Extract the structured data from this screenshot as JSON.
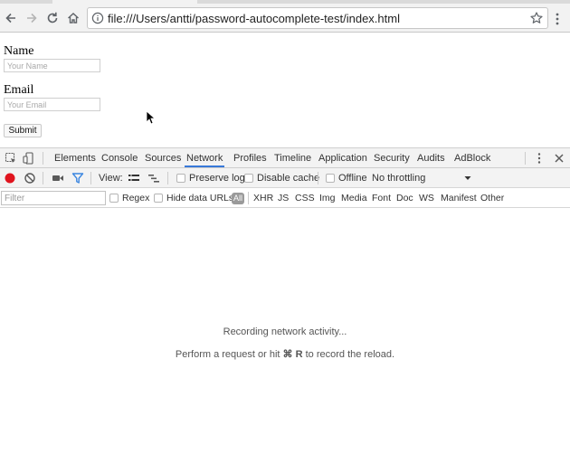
{
  "browser": {
    "url": "file:///Users/antti/password-autocomplete-test/index.html",
    "nav": [
      "back-icon",
      "forward-icon",
      "reload-icon",
      "home-icon"
    ]
  },
  "page": {
    "name_label": "Name",
    "name_placeholder": "Your Name",
    "email_label": "Email",
    "email_placeholder": "Your Email",
    "submit_label": "Submit"
  },
  "devtools": {
    "tabs": [
      "Elements",
      "Console",
      "Sources",
      "Network",
      "Profiles",
      "Timeline",
      "Application",
      "Security",
      "Audits",
      "AdBlock"
    ],
    "active_tab": "Network",
    "toolbar": {
      "view_label": "View:",
      "preserve_log": "Preserve log",
      "disable_cache": "Disable cache",
      "offline": "Offline",
      "throttling": "No throttling"
    },
    "filter": {
      "placeholder": "Filter",
      "regex": "Regex",
      "hide_data_urls": "Hide data URLs",
      "types": [
        "All",
        "XHR",
        "JS",
        "CSS",
        "Img",
        "Media",
        "Font",
        "Doc",
        "WS",
        "Manifest",
        "Other"
      ]
    },
    "empty": {
      "recording": "Recording network activity...",
      "hint_before": "Perform a request or hit",
      "hint_keys": "⌘ R",
      "hint_after": "to record the reload."
    }
  },
  "colors": {
    "active_tab_underline": "#3879d9",
    "record_red": "#e0141e",
    "filter_funnel_blue": "#3b86e0"
  }
}
